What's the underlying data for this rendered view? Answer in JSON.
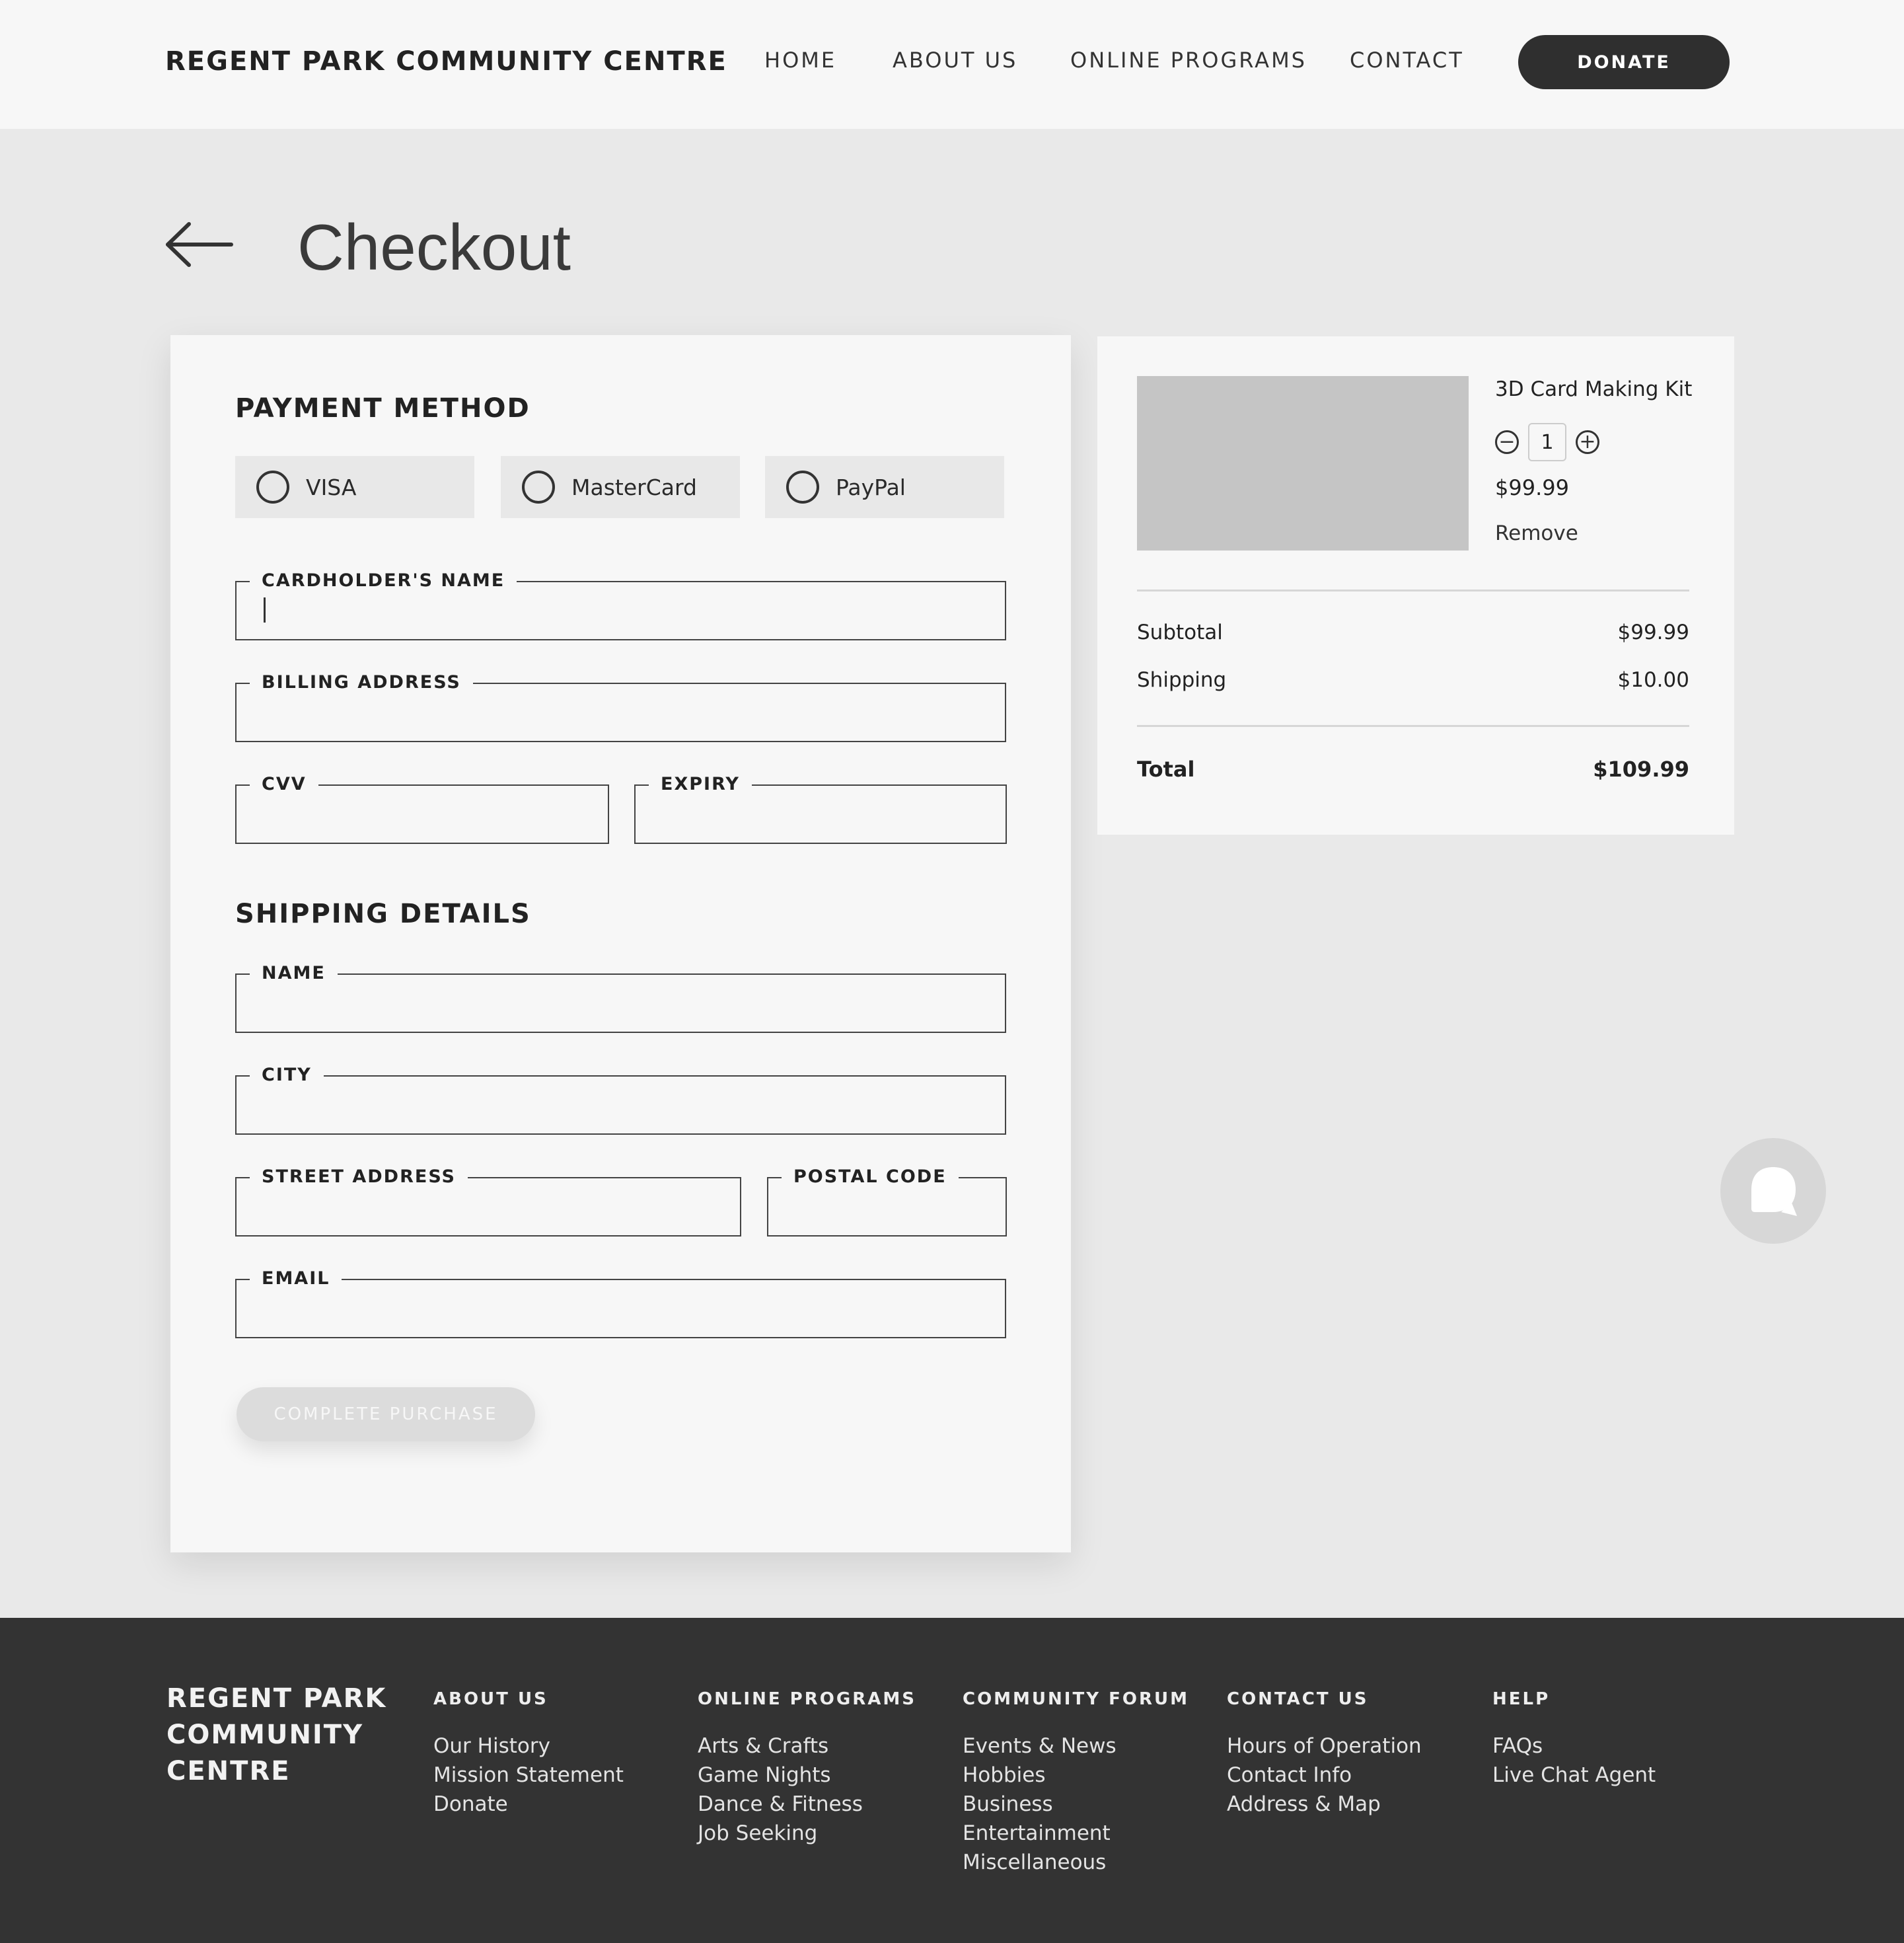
{
  "header": {
    "brand": "REGENT PARK COMMUNITY CENTRE",
    "nav": [
      "HOME",
      "ABOUT US",
      "ONLINE PROGRAMS",
      "CONTACT"
    ],
    "donate_label": "DONATE"
  },
  "page": {
    "title": "Checkout",
    "back_icon": "arrow-left-icon"
  },
  "payment": {
    "title": "PAYMENT METHOD",
    "options": [
      "VISA",
      "MasterCard",
      "PayPal"
    ],
    "fields": {
      "cardholder": "CARDHOLDER'S NAME",
      "billing": "BILLING ADDRESS",
      "cvv": "CVV",
      "expiry": "EXPIRY"
    }
  },
  "shipping": {
    "title": "SHIPPING DETAILS",
    "fields": {
      "name": "NAME",
      "city": "CITY",
      "street": "STREET ADDRESS",
      "postal": "POSTAL CODE",
      "email": "EMAIL"
    }
  },
  "purchase_label": "COMPLETE PURCHASE",
  "summary": {
    "product_name": "3D Card Making Kit",
    "quantity": "1",
    "price": "$99.99",
    "remove_label": "Remove",
    "subtotal_label": "Subtotal",
    "subtotal_value": "$99.99",
    "shipping_label": "Shipping",
    "shipping_value": "$10.00",
    "total_label": "Total",
    "total_value": "$109.99"
  },
  "footer": {
    "brand": "REGENT PARK COMMUNITY CENTRE",
    "columns": [
      {
        "title": "ABOUT US",
        "links": [
          "Our History",
          "Mission Statement",
          "Donate"
        ]
      },
      {
        "title": "ONLINE PROGRAMS",
        "links": [
          "Arts & Crafts",
          "Game Nights",
          "Dance & Fitness",
          "Job Seeking"
        ]
      },
      {
        "title": "COMMUNITY FORUM",
        "links": [
          "Events & News",
          "Hobbies",
          "Business",
          "Entertainment",
          "Miscellaneous"
        ]
      },
      {
        "title": "CONTACT US",
        "links": [
          "Hours of Operation",
          "Contact Info",
          "Address & Map"
        ]
      },
      {
        "title": "HELP",
        "links": [
          "FAQs",
          "Live Chat Agent"
        ]
      }
    ]
  },
  "colors": {
    "dark": "#2f2f2f",
    "card": "#f7f7f7",
    "page_bg": "#e9e9e9",
    "disabled_btn": "#dcdcdc"
  }
}
